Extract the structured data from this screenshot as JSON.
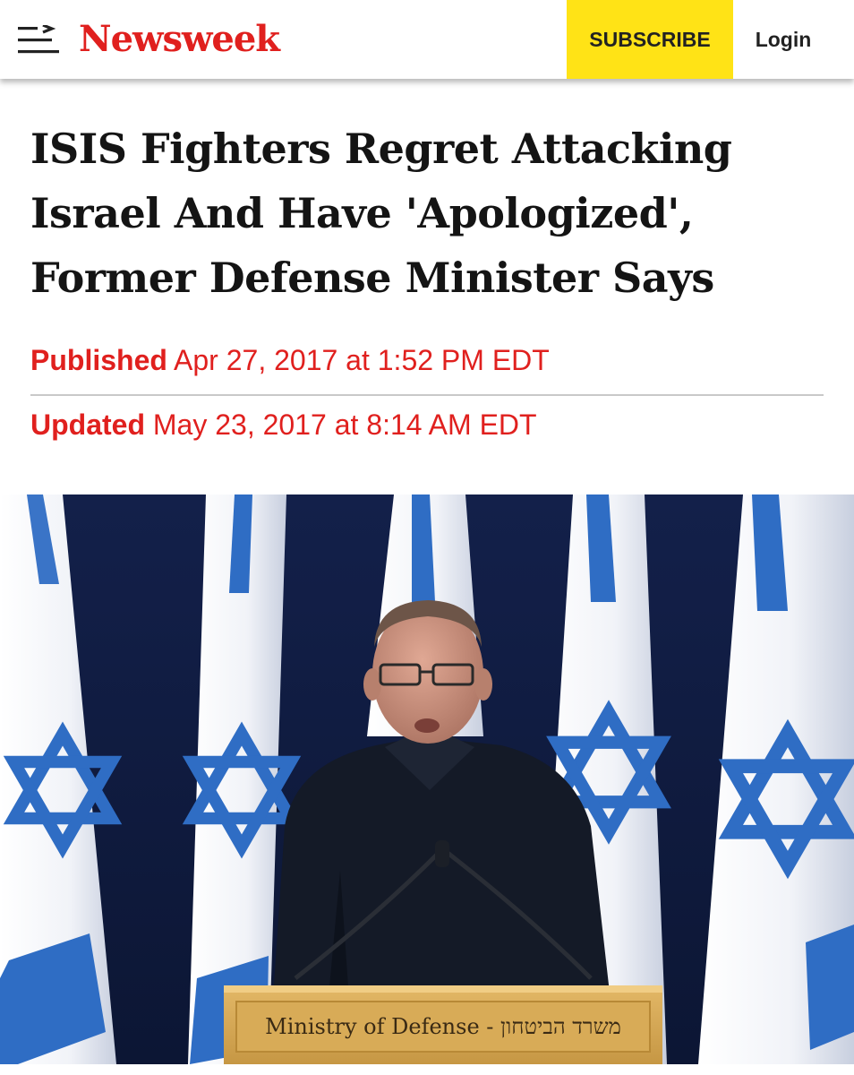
{
  "header": {
    "menu_icon": "menu-arrow-icon",
    "logo_text": "Newsweek",
    "subscribe_label": "SUBSCRIBE",
    "login_label": "Login"
  },
  "article": {
    "headline": "ISIS Fighters Regret Attacking Israel And Have 'Apologized', Former Defense Minister Says",
    "published_label": "Published",
    "published_value": "Apr 27, 2017 at 1:52 PM EDT",
    "updated_label": "Updated",
    "updated_value": "May 23, 2017 at 8:14 AM EDT"
  },
  "photo": {
    "podium_text": "Ministry of Defense - משרד הביטחון"
  },
  "colors": {
    "brand_red": "#e0201e",
    "subscribe_yellow": "#ffe316",
    "flag_blue": "#2f6dc4"
  }
}
